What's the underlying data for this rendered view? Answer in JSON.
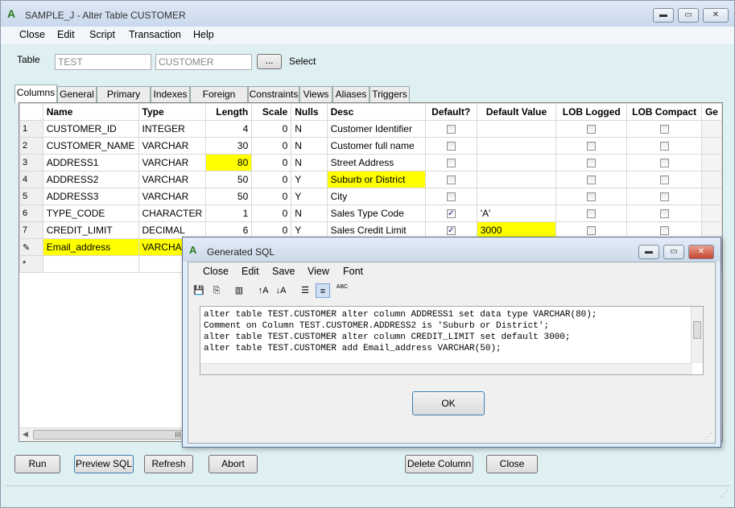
{
  "window": {
    "title": "SAMPLE_J - Alter Table CUSTOMER",
    "min": "▬",
    "max": "▭",
    "close": "✕"
  },
  "menu": [
    "Close",
    "Edit",
    "Script",
    "Transaction",
    "Help"
  ],
  "table_field": {
    "label": "Table",
    "schema": "TEST",
    "name": "CUSTOMER",
    "browse": "...",
    "select": "Select"
  },
  "tabs": [
    "Columns",
    "General",
    "Primary Key",
    "Indexes",
    "Foreign Keys",
    "Constraints",
    "Views",
    "Aliases",
    "Triggers"
  ],
  "grid": {
    "headers": [
      "Name",
      "Type",
      "Length",
      "Scale",
      "Nulls",
      "Desc",
      "Default?",
      "Default Value",
      "LOB Logged",
      "LOB Compact",
      "Ge"
    ],
    "rows": [
      {
        "n": "1",
        "name": "CUSTOMER_ID",
        "type": "INTEGER",
        "length": "4",
        "scale": "0",
        "nulls": "N",
        "desc": "Customer Identifier",
        "def": false,
        "defval": ""
      },
      {
        "n": "2",
        "name": "CUSTOMER_NAME",
        "type": "VARCHAR",
        "length": "30",
        "scale": "0",
        "nulls": "N",
        "desc": "Customer full name",
        "def": false,
        "defval": ""
      },
      {
        "n": "3",
        "name": "ADDRESS1",
        "type": "VARCHAR",
        "length": "80",
        "scale": "0",
        "nulls": "N",
        "desc": "Street Address",
        "def": false,
        "defval": ""
      },
      {
        "n": "4",
        "name": "ADDRESS2",
        "type": "VARCHAR",
        "length": "50",
        "scale": "0",
        "nulls": "Y",
        "desc": "Suburb or District",
        "def": false,
        "defval": ""
      },
      {
        "n": "5",
        "name": "ADDRESS3",
        "type": "VARCHAR",
        "length": "50",
        "scale": "0",
        "nulls": "Y",
        "desc": "City",
        "def": false,
        "defval": ""
      },
      {
        "n": "6",
        "name": "TYPE_CODE",
        "type": "CHARACTER",
        "length": "1",
        "scale": "0",
        "nulls": "N",
        "desc": "Sales Type Code",
        "def": true,
        "defval": "'A'"
      },
      {
        "n": "7",
        "name": "CREDIT_LIMIT",
        "type": "DECIMAL",
        "length": "6",
        "scale": "0",
        "nulls": "Y",
        "desc": "Sales Credit Limit",
        "def": true,
        "defval": "3000"
      },
      {
        "n": "✎",
        "name": "Email_address",
        "type": "VARCHAR",
        "length": "",
        "scale": "",
        "nulls": "",
        "desc": "",
        "def": null,
        "defval": ""
      },
      {
        "n": "*",
        "name": "",
        "type": "",
        "length": "",
        "scale": "",
        "nulls": "",
        "desc": "",
        "def": null,
        "defval": ""
      }
    ],
    "scroll_grip": "III"
  },
  "buttons": {
    "run": "Run",
    "preview": "Preview SQL",
    "refresh": "Refresh",
    "abort": "Abort",
    "delete": "Delete Column",
    "close": "Close"
  },
  "dialog": {
    "title": "Generated SQL",
    "menu": [
      "Close",
      "Edit",
      "Save",
      "View",
      "Font"
    ],
    "toolbar_icons": [
      "save-icon",
      "copy-icon",
      "columns-icon",
      "sort-asc-icon",
      "sort-desc-icon",
      "wrap-icon",
      "align-icon",
      "uppercase-icon"
    ],
    "toolbar_glyphs": [
      "💾",
      "⎘",
      "▥",
      "↑A",
      "↓A",
      "☰",
      "≡",
      "ABC"
    ],
    "sql": [
      "alter table TEST.CUSTOMER alter column ADDRESS1 set data type VARCHAR(80);",
      "Comment on Column TEST.CUSTOMER.ADDRESS2 is 'Suburb or District';",
      "alter table TEST.CUSTOMER alter column CREDIT_LIMIT set default 3000;",
      "alter table TEST.CUSTOMER add  Email_address  VARCHAR(50);"
    ],
    "ok": "OK"
  }
}
